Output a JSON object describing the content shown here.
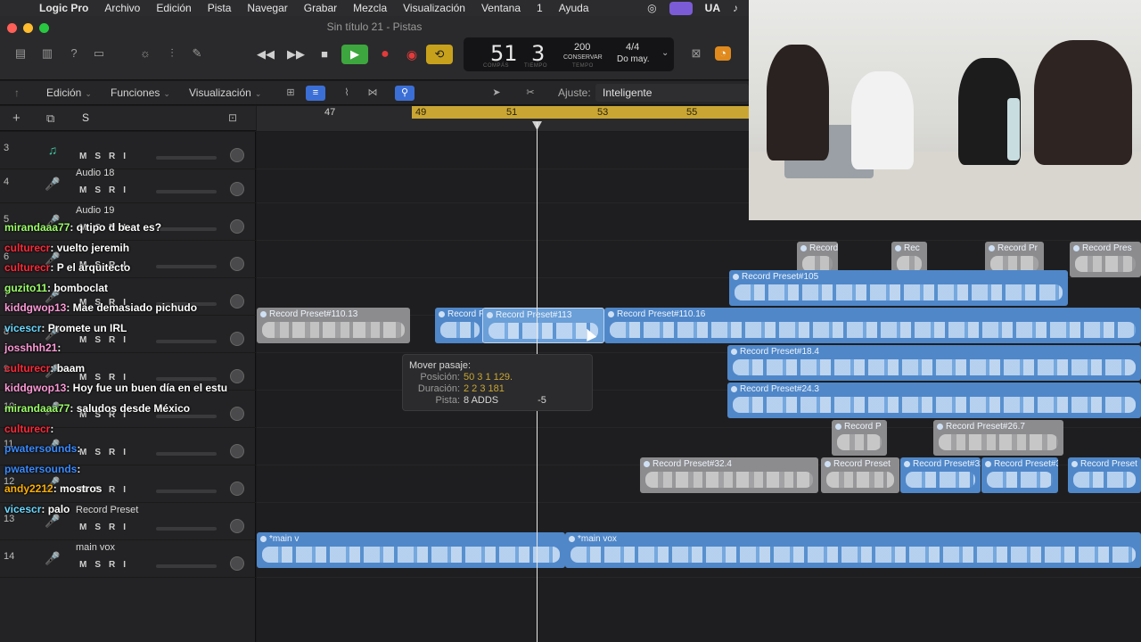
{
  "menubar": {
    "app": "Logic Pro",
    "items": [
      "Archivo",
      "Edición",
      "Pista",
      "Navegar",
      "Grabar",
      "Mezcla",
      "Visualización",
      "Ventana",
      "1",
      "Ayuda"
    ],
    "input_source": "UA"
  },
  "window": {
    "title": "Sin título 21 - Pistas"
  },
  "lcd": {
    "bar": "51",
    "beat": "3",
    "bar_label": "COMPÁS",
    "beat_label": "TIEMPO",
    "tempo": "200",
    "tempo_mode": "CONSERVAR",
    "tempo_label": "TEMPO",
    "time_signature": "4/4",
    "key": "Do may."
  },
  "edit_bar": {
    "edit_menu": "Edición",
    "functions_menu": "Funciones",
    "view_menu": "Visualización",
    "snap_label": "Ajuste:",
    "snap_value": "Inteligente"
  },
  "track_toolbar": {
    "solo_label": "S"
  },
  "tracks": [
    {
      "num": "3",
      "name": ""
    },
    {
      "num": "4",
      "name": "Audio 18"
    },
    {
      "num": "5",
      "name": "Audio 19"
    },
    {
      "num": "6",
      "name": ""
    },
    {
      "num": "7",
      "name": ""
    },
    {
      "num": "8",
      "name": ""
    },
    {
      "num": "9",
      "name": ""
    },
    {
      "num": "10",
      "name": ""
    },
    {
      "num": "11",
      "name": ""
    },
    {
      "num": "12",
      "name": ""
    },
    {
      "num": "13",
      "name": "Record Preset"
    },
    {
      "num": "14",
      "name": "main vox"
    }
  ],
  "track_buttons": {
    "mute": "M",
    "solo": "S",
    "record": "R",
    "input": "I"
  },
  "chat": [
    {
      "user": "mirandaaa77",
      "color": "#9dff6a",
      "msg": ": q tipo d beat es?"
    },
    {
      "user": "culturecr",
      "color": "#ff2a3a",
      "msg": ": vuelto jeremih"
    },
    {
      "user": "culturecr",
      "color": "#ff2a3a",
      "msg": ": P el arquitecto"
    },
    {
      "user": "guzito11",
      "color": "#9dff6a",
      "msg": ": bomboclat"
    },
    {
      "user": "kiddgwop13",
      "color": "#ff9ad8",
      "msg": ": Mae demasiado pichudo"
    },
    {
      "user": "vicescr",
      "color": "#6ad8ff",
      "msg": ": Promete un IRL"
    },
    {
      "user": "josshhh21",
      "color": "#ff9ad8",
      "msg": ": "
    },
    {
      "user": "culturecr",
      "color": "#ff2a3a",
      "msg": ": baam"
    },
    {
      "user": "kiddgwop13",
      "color": "#ff9ad8",
      "msg": ": Hoy fue un buen día en el estu"
    },
    {
      "user": "mirandaaa77",
      "color": "#9dff6a",
      "msg": ": saludos desde México"
    },
    {
      "user": "culturecr",
      "color": "#ff2a3a",
      "msg": ": "
    },
    {
      "user": "pwatersounds",
      "color": "#3a8bff",
      "msg": ": "
    },
    {
      "user": "pwatersounds",
      "color": "#3a8bff",
      "msg": ": "
    },
    {
      "user": "andy2212",
      "color": "#ffb000",
      "msg": ": mostros"
    },
    {
      "user": "vicescr",
      "color": "#6ad8ff",
      "msg": ": palo"
    }
  ],
  "ruler": {
    "marks": [
      "47",
      "49",
      "51",
      "53",
      "55"
    ]
  },
  "regions": [
    {
      "lane": 2,
      "name": "Record",
      "style": "gray"
    },
    {
      "lane": 2,
      "name": "Rec",
      "style": "gray"
    },
    {
      "lane": 2,
      "name": "Record Pr",
      "style": "gray"
    },
    {
      "lane": 2,
      "name": "Record Pres",
      "style": "gray"
    },
    {
      "lane": 3,
      "name": "Record Preset#105",
      "style": "blue"
    },
    {
      "lane": 4,
      "name": "Record Preset#110.13",
      "style": "gray"
    },
    {
      "lane": 4,
      "name": "Record Pre",
      "style": "blue"
    },
    {
      "lane": 4,
      "name": "Record Preset#113",
      "style": "lblue"
    },
    {
      "lane": 4,
      "name": "Record Preset#110.16",
      "style": "blue"
    },
    {
      "lane": 5,
      "name": "Record Preset#18.4",
      "style": "blue"
    },
    {
      "lane": 6,
      "name": "Record Preset#24.3",
      "style": "blue"
    },
    {
      "lane": 7,
      "name": "Record P",
      "style": "gray"
    },
    {
      "lane": 7,
      "name": "Record Preset#26.7",
      "style": "gray"
    },
    {
      "lane": 8,
      "name": "Record Preset#32.4",
      "style": "gray"
    },
    {
      "lane": 8,
      "name": "Record Preset",
      "style": "gray"
    },
    {
      "lane": 8,
      "name": "Record Preset#32.",
      "style": "blue"
    },
    {
      "lane": 8,
      "name": "Record Preset#3",
      "style": "blue"
    },
    {
      "lane": 8,
      "name": "Record Preset",
      "style": "blue"
    },
    {
      "lane": 10,
      "name": "*main v",
      "style": "blue"
    },
    {
      "lane": 10,
      "name": "*main vox",
      "style": "blue"
    }
  ],
  "tooltip": {
    "title": "Mover pasaje:",
    "position_label": "Posición:",
    "position_value": "50 3 1 129.",
    "duration_label": "Duración:",
    "duration_value": "2 2 3 181",
    "track_label": "Pista:",
    "track_value": "8  ADDS",
    "track_offset": "-5"
  },
  "colors": {
    "accent_cycle": "#c9a634",
    "region_blue": "#4f87c9",
    "region_gray": "#8c8c8f",
    "play_green": "#3ea63e",
    "record_red": "#e23b3b"
  }
}
